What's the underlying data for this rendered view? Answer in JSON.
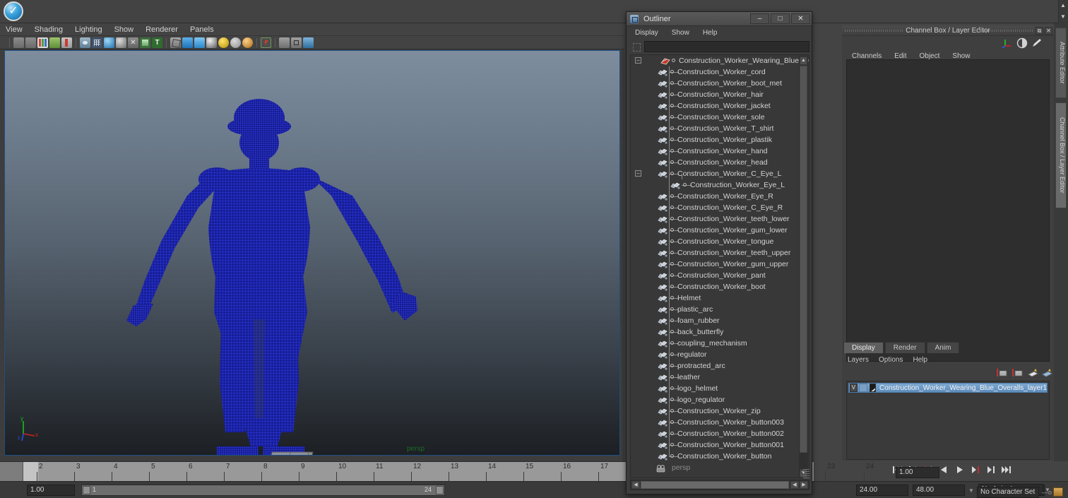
{
  "app": {
    "logo_icon": "maya-check-logo"
  },
  "viewport_panel": {
    "menus": [
      "View",
      "Shading",
      "Lighting",
      "Show",
      "Renderer",
      "Panels"
    ],
    "camera_label": "persp",
    "axis": {
      "x": "x",
      "y": "y",
      "z": "z"
    },
    "toolbar_icons": [
      "select-camera-icon",
      "camera-attributes-icon",
      "display-bars-icon",
      "shading-leaf-icon",
      "pin-icon",
      "separator",
      "xray-eye-icon",
      "grid-icon",
      "sphere-blue-icon",
      "sphere-gray-icon",
      "wireframe-x-icon",
      "texture-icon",
      "text-T-icon",
      "separator",
      "polygon-icon",
      "cube-solid-icon",
      "cube-shaded-icon",
      "film-icon",
      "light-yellow-icon",
      "light-gray-icon",
      "light-orange-icon",
      "separator",
      "selection-highlight-icon",
      "separator",
      "box-icon",
      "box-outline-icon",
      "share-icon"
    ]
  },
  "outliner": {
    "window_title": "Outliner",
    "window_icon": "outliner-icon",
    "window_buttons": {
      "minimize": "–",
      "maximize": "□",
      "close": "✕"
    },
    "menus": [
      "Display",
      "Show",
      "Help"
    ],
    "search_value": "",
    "search_placeholder": "",
    "root": {
      "label": "Construction_Worker_Wearing_Blue_Overalls",
      "expanded": true,
      "icon": "transform-group-icon"
    },
    "items": [
      {
        "label": "Construction_Worker_cord",
        "depth": 1,
        "expandable": false
      },
      {
        "label": "Construction_Worker_boot_met",
        "depth": 1,
        "expandable": false
      },
      {
        "label": "Construction_Worker_hair",
        "depth": 1,
        "expandable": false
      },
      {
        "label": "Construction_Worker_jacket",
        "depth": 1,
        "expandable": false
      },
      {
        "label": "Construction_Worker_sole",
        "depth": 1,
        "expandable": false
      },
      {
        "label": "Construction_Worker_T_shirt",
        "depth": 1,
        "expandable": false
      },
      {
        "label": "Construction_Worker_plastik",
        "depth": 1,
        "expandable": false
      },
      {
        "label": "Construction_Worker_hand",
        "depth": 1,
        "expandable": false
      },
      {
        "label": "Construction_Worker_head",
        "depth": 1,
        "expandable": false
      },
      {
        "label": "Construction_Worker_C_Eye_L",
        "depth": 1,
        "expandable": true
      },
      {
        "label": "Construction_Worker_Eye_L",
        "depth": 2,
        "expandable": false
      },
      {
        "label": "Construction_Worker_Eye_R",
        "depth": 1,
        "expandable": false
      },
      {
        "label": "Construction_Worker_C_Eye_R",
        "depth": 1,
        "expandable": false
      },
      {
        "label": "Construction_Worker_teeth_lower",
        "depth": 1,
        "expandable": false
      },
      {
        "label": "Construction_Worker_gum_lower",
        "depth": 1,
        "expandable": false
      },
      {
        "label": "Construction_Worker_tongue",
        "depth": 1,
        "expandable": false
      },
      {
        "label": "Construction_Worker_teeth_upper",
        "depth": 1,
        "expandable": false
      },
      {
        "label": "Construction_Worker_gum_upper",
        "depth": 1,
        "expandable": false
      },
      {
        "label": "Construction_Worker_pant",
        "depth": 1,
        "expandable": false
      },
      {
        "label": "Construction_Worker_boot",
        "depth": 1,
        "expandable": false
      },
      {
        "label": "Helmet",
        "depth": 1,
        "expandable": false
      },
      {
        "label": "plastic_arc",
        "depth": 1,
        "expandable": false
      },
      {
        "label": "foam_rubber",
        "depth": 1,
        "expandable": false
      },
      {
        "label": "back_butterfly",
        "depth": 1,
        "expandable": false
      },
      {
        "label": "coupling_mechanism",
        "depth": 1,
        "expandable": false
      },
      {
        "label": "regulator",
        "depth": 1,
        "expandable": false
      },
      {
        "label": "protracted_arc",
        "depth": 1,
        "expandable": false
      },
      {
        "label": "leather",
        "depth": 1,
        "expandable": false
      },
      {
        "label": "logo_helmet",
        "depth": 1,
        "expandable": false
      },
      {
        "label": "logo_regulator",
        "depth": 1,
        "expandable": false
      },
      {
        "label": "Construction_Worker_zip",
        "depth": 1,
        "expandable": false
      },
      {
        "label": "Construction_Worker_button003",
        "depth": 1,
        "expandable": false
      },
      {
        "label": "Construction_Worker_button002",
        "depth": 1,
        "expandable": false
      },
      {
        "label": "Construction_Worker_button001",
        "depth": 1,
        "expandable": false
      },
      {
        "label": "Construction_Worker_button",
        "depth": 1,
        "expandable": false
      },
      {
        "label": "persp",
        "depth": 0,
        "expandable": false,
        "type": "camera"
      }
    ]
  },
  "channel_box": {
    "title": "Channel Box / Layer Editor",
    "menus": [
      "Channels",
      "Edit",
      "Object",
      "Show"
    ],
    "header_icons": [
      "axis-move-icon",
      "half-circle-icon",
      "pencil-icon"
    ],
    "window_buttons": {
      "undock": "⧉",
      "close": "✕"
    }
  },
  "layer_editor": {
    "tabs": [
      "Display",
      "Render",
      "Anim"
    ],
    "active_tab": "Display",
    "menus": [
      "Layers",
      "Options",
      "Help"
    ],
    "toolbar_icons": [
      "new-layer-icon",
      "new-layer-selected-icon",
      "layer-up-icon",
      "layer-down-icon"
    ],
    "layers": [
      {
        "visibility": "V",
        "mode": "",
        "name": "Construction_Worker_Wearing_Blue_Overalls_layer1",
        "selected": true
      }
    ]
  },
  "vertical_tabs": [
    {
      "label": "Attribute Editor",
      "active": false
    },
    {
      "label": "Channel Box / Layer Editor",
      "active": true
    }
  ],
  "timeline": {
    "ticks": [
      2,
      3,
      4,
      5,
      6,
      7,
      8,
      9,
      10,
      11,
      12,
      13,
      14,
      15,
      16,
      17,
      23,
      24
    ],
    "current_frame": "1.00",
    "range_start": "1",
    "range_end": "24",
    "range_min": "1.00",
    "anim_start": "24.00",
    "anim_end": "48.00",
    "anim_layer": "No Anim Layer",
    "character_set": "No Character Set",
    "playback_speed": "1.00"
  },
  "playback_buttons": [
    "go-to-start-icon",
    "step-back-keyframe-icon",
    "step-back-frame-icon",
    "play-backwards-icon",
    "play-forwards-icon",
    "step-forward-frame-icon",
    "step-forward-keyframe-icon",
    "go-to-end-icon"
  ],
  "colors": {
    "wireframe": "#1b23b5",
    "viewport_top": "#7e8d9e",
    "viewport_bottom": "#1c1f23",
    "selection": "#5d8cbb",
    "persp_label": "#1f6b29"
  }
}
